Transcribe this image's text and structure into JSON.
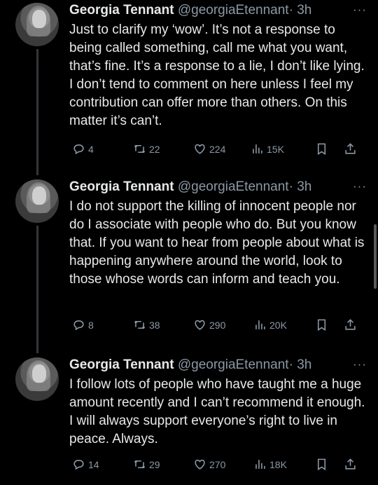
{
  "tweets": [
    {
      "name": "Georgia Tennant",
      "handle": "@georgiaEtennant",
      "time": "· 3h",
      "more": "···",
      "text": "Just to clarify my ‘wow’. It’s not a response to being called something, call me what you want, that’s fine. It’s a response to a lie, I don’t like lying. I don’t tend to comment on here unless I feel my contribution can offer more than others. On this matter it’s can’t.",
      "replies": "4",
      "retweets": "22",
      "likes": "224",
      "views": "15K"
    },
    {
      "name": "Georgia Tennant",
      "handle": "@georgiaEtennant",
      "time": "· 3h",
      "more": "···",
      "text": "I do not support the killing of innocent people nor do I associate with people who do. But you know that. If you want to hear from people about what is happening anywhere around the world, look to those whose words can inform and teach you.",
      "replies": "8",
      "retweets": "38",
      "likes": "290",
      "views": "20K"
    },
    {
      "name": "Georgia Tennant",
      "handle": "@georgiaEtennant",
      "time": "· 3h",
      "more": "···",
      "text": "I follow lots of people who have taught me a huge amount recently and I can’t recommend it enough. I will always support everyone’s right to live in peace. Always.",
      "replies": "14",
      "retweets": "29",
      "likes": "270",
      "views": "18K"
    }
  ],
  "colors": {
    "background": "#000000",
    "text": "#e7e9ea",
    "muted": "#8b98a5",
    "thread_line": "#333639"
  },
  "icons": [
    "reply-icon",
    "retweet-icon",
    "like-icon",
    "views-icon",
    "bookmark-icon",
    "share-icon",
    "more-icon"
  ]
}
